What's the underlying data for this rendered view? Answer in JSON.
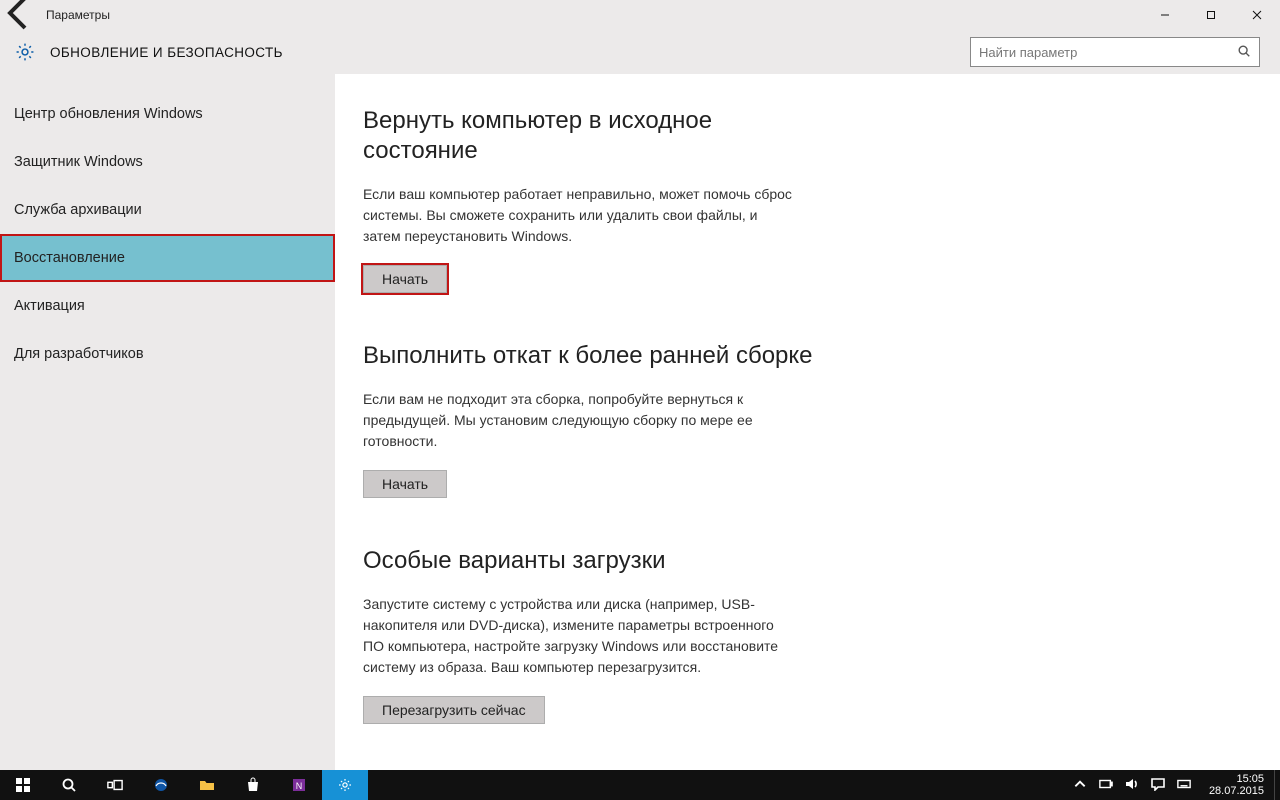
{
  "window": {
    "title": "Параметры",
    "minimize": "–",
    "maximize": "☐",
    "close": "✕"
  },
  "header": {
    "section_title": "ОБНОВЛЕНИЕ И БЕЗОПАСНОСТЬ",
    "search_placeholder": "Найти параметр"
  },
  "sidebar": {
    "items": [
      {
        "label": "Центр обновления Windows"
      },
      {
        "label": "Защитник Windows"
      },
      {
        "label": "Служба архивации"
      },
      {
        "label": "Восстановление"
      },
      {
        "label": "Активация"
      },
      {
        "label": "Для разработчиков"
      }
    ],
    "selected_index": 3
  },
  "content": {
    "sections": [
      {
        "heading": "Вернуть компьютер в исходное состояние",
        "body": "Если ваш компьютер работает неправильно, может помочь сброс системы. Вы сможете сохранить или удалить свои файлы, и затем переустановить Windows.",
        "button": "Начать",
        "highlighted": true
      },
      {
        "heading": "Выполнить откат к более ранней сборке",
        "body": "Если вам не подходит эта сборка, попробуйте вернуться к предыдущей. Мы установим следующую сборку по мере ее готовности.",
        "button": "Начать",
        "highlighted": false
      },
      {
        "heading": "Особые варианты загрузки",
        "body": "Запустите систему с устройства или диска (например, USB-накопителя или DVD-диска), измените параметры встроенного ПО компьютера, настройте загрузку Windows или восстановите систему из образа. Ваш компьютер перезагрузится.",
        "button": "Перезагрузить сейчас",
        "highlighted": false
      }
    ]
  },
  "taskbar": {
    "time": "15:05",
    "date": "28.07.2015"
  }
}
